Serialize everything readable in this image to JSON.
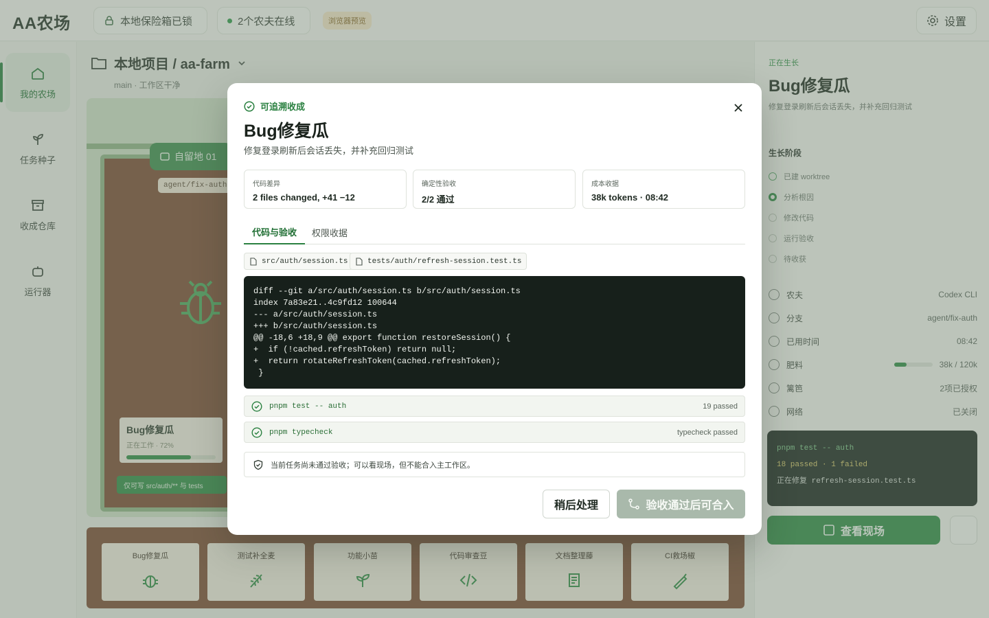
{
  "app": {
    "logo": "AA农场"
  },
  "topbar": {
    "vault_label": "本地保险箱已锁",
    "online_label": "2个农夫在线",
    "preview_badge": "浏览器预览",
    "settings_label": "设置"
  },
  "nav": {
    "items": [
      {
        "label": "我的农场",
        "icon": "home-icon",
        "active": true
      },
      {
        "label": "任务种子",
        "icon": "sprout-icon"
      },
      {
        "label": "收成仓库",
        "icon": "archive-icon"
      },
      {
        "label": "运行器",
        "icon": "robot-icon"
      }
    ]
  },
  "main": {
    "project_title": "本地项目 / aa-farm",
    "branch_line": "main · 工作区干净",
    "plot": {
      "tag": "自留地 01",
      "branch": "agent/fix-auth",
      "card_title": "Bug修复瓜",
      "card_sub": "正在工作 · 72%",
      "progress": 0.72,
      "note": "仅可写 src/auth/** 与 tests"
    },
    "seeds": [
      {
        "label": "Bug修复瓜",
        "icon": "bug-icon"
      },
      {
        "label": "测试补全麦",
        "icon": "wheat-icon"
      },
      {
        "label": "功能小苗",
        "icon": "sprout-icon"
      },
      {
        "label": "代码审查豆",
        "icon": "code-icon"
      },
      {
        "label": "文档整理藤",
        "icon": "scroll-icon"
      },
      {
        "label": "CI救场椒",
        "icon": "pepper-icon"
      }
    ]
  },
  "right_panel": {
    "kicker": "正在生长",
    "title": "Bug修复瓜",
    "subtitle": "修复登录刷新后会话丢失，并补充回归测试",
    "stages_title": "生长阶段",
    "stages": [
      {
        "label": "已建 worktree",
        "state": "done"
      },
      {
        "label": "分析根因",
        "state": "current"
      },
      {
        "label": "修改代码",
        "state": "todo"
      },
      {
        "label": "运行验收",
        "state": "todo"
      },
      {
        "label": "待收获",
        "state": "todo"
      }
    ],
    "meta": [
      {
        "label": "农夫",
        "value": "Codex CLI"
      },
      {
        "label": "分支",
        "value": "agent/fix-auth"
      },
      {
        "label": "已用时间",
        "value": "08:42"
      },
      {
        "label": "肥料",
        "value": "38k / 120k",
        "fill": 0.32
      },
      {
        "label": "篱笆",
        "value": "2项已授权"
      },
      {
        "label": "网络",
        "value": "已关闭"
      }
    ],
    "terminal": [
      "pnpm test -- auth",
      "18 passed · 1 failed",
      "正在修复 refresh-session.test.ts"
    ],
    "view_button": "查看现场"
  },
  "modal": {
    "kicker": "可追溯收成",
    "title": "Bug修复瓜",
    "description": "修复登录刷新后会话丢失，并补充回归测试",
    "stats": [
      {
        "label": "代码差异",
        "value": "2 files changed, +41 −12"
      },
      {
        "label": "确定性验收",
        "value": "2/2 通过"
      },
      {
        "label": "成本收据",
        "value": "38k tokens · 08:42"
      }
    ],
    "tabs": [
      {
        "label": "代码与验收",
        "active": true
      },
      {
        "label": "权限收据",
        "active": false
      }
    ],
    "files": [
      "src/auth/session.ts",
      "tests/auth/refresh-session.test.ts"
    ],
    "diff": "diff --git a/src/auth/session.ts b/src/auth/session.ts\nindex 7a83e21..4c9fd12 100644\n--- a/src/auth/session.ts\n+++ b/src/auth/session.ts\n@@ -18,6 +18,9 @@ export function restoreSession() {\n+  if (!cached.refreshToken) return null;\n+  return rotateRefreshToken(cached.refreshToken);\n }",
    "checks": [
      {
        "command": "pnpm test -- auth",
        "result": "19 passed"
      },
      {
        "command": "pnpm typecheck",
        "result": "typecheck passed"
      }
    ],
    "warning": "当前任务尚未通过验收；可以看现场，但不能合入主工作区。",
    "later_button": "稍后处理",
    "merge_button": "验收通过后可合入"
  }
}
